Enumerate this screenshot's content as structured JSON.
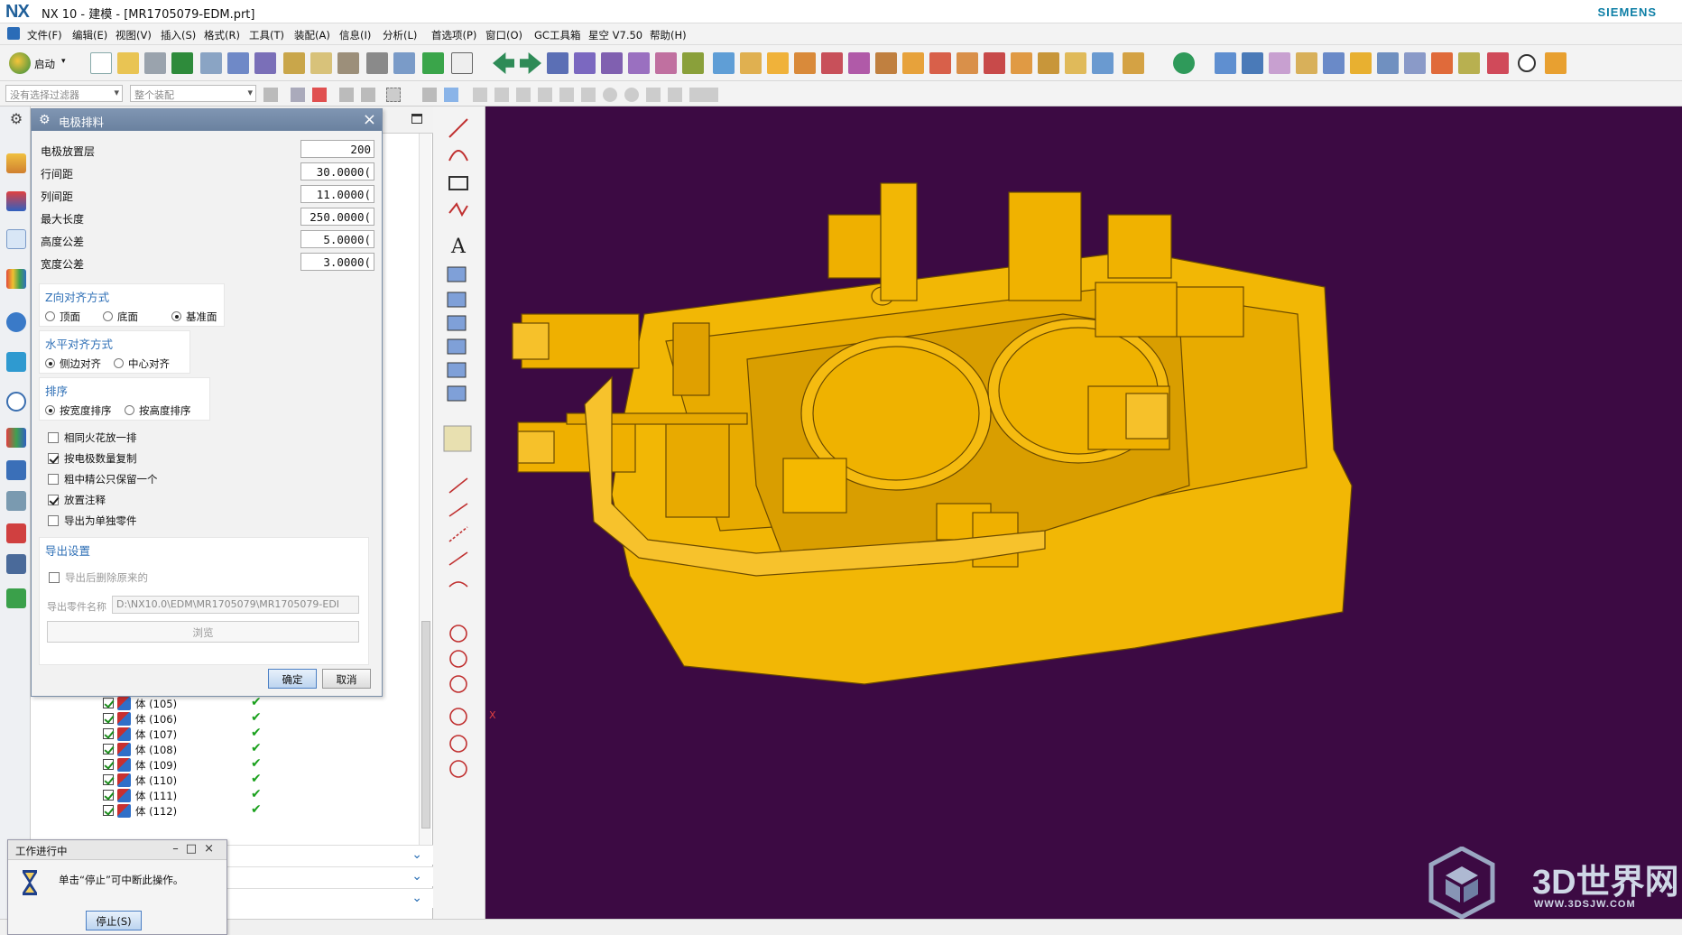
{
  "window": {
    "logo": "NX",
    "title": "NX 10 - 建模 - [MR1705079-EDM.prt]",
    "brand": "SIEMENS"
  },
  "menu": [
    "文件(F)",
    "编辑(E)",
    "视图(V)",
    "插入(S)",
    "格式(R)",
    "工具(T)",
    "装配(A)",
    "信息(I)",
    "分析(L)",
    "首选项(P)",
    "窗口(O)",
    "GC工具箱",
    "星空 V7.50",
    "帮助(H)"
  ],
  "toolbar": {
    "start_label": "启动",
    "filter_placeholder": "没有选择过滤器",
    "assembly_placeholder": "整个装配"
  },
  "dialog": {
    "title": "电极排料",
    "fields": [
      {
        "label": "电极放置层",
        "value": "200"
      },
      {
        "label": "行间距",
        "value": "30.0000("
      },
      {
        "label": "列间距",
        "value": "11.0000("
      },
      {
        "label": "最大长度",
        "value": "250.0000("
      },
      {
        "label": "高度公差",
        "value": "5.0000("
      },
      {
        "label": "宽度公差",
        "value": "3.0000("
      }
    ],
    "z_align": {
      "title": "Z向对齐方式",
      "options": [
        "顶面",
        "底面",
        "基准面"
      ],
      "selected": 2
    },
    "h_align": {
      "title": "水平对齐方式",
      "options": [
        "侧边对齐",
        "中心对齐"
      ],
      "selected": 0
    },
    "sort": {
      "title": "排序",
      "options": [
        "按宽度排序",
        "按高度排序"
      ],
      "selected": 0
    },
    "checkboxes": [
      {
        "label": "相同火花放一排",
        "checked": false
      },
      {
        "label": "按电极数量复制",
        "checked": true
      },
      {
        "label": "粗中精公只保留一个",
        "checked": false
      },
      {
        "label": "放置注释",
        "checked": true
      },
      {
        "label": "导出为单独零件",
        "checked": false
      }
    ],
    "export": {
      "title": "导出设置",
      "delete_label": "导出后删除原来的",
      "name_label": "导出零件名称",
      "name_value": "D:\\NX10.0\\EDM\\MR1705079\\MR1705079-EDI",
      "browse_label": "浏览"
    },
    "ok_label": "确定",
    "cancel_label": "取消"
  },
  "tree_rows": [
    "体 (105)",
    "体 (106)",
    "体 (107)",
    "体 (108)",
    "体 (109)",
    "体 (110)",
    "体 (111)",
    "体 (112)"
  ],
  "progress": {
    "title": "工作进行中",
    "message": "单击“停止”可中断此操作。",
    "stop_label": "停止(S)"
  },
  "triad": {
    "x_label": "X"
  },
  "watermark": {
    "text": "3D世界网",
    "url": "WWW.3DSJW.COM"
  },
  "colors": {
    "graphics_bg": "#3c0a43",
    "model": "#f2b705",
    "model_edge": "#6b4a00",
    "accent": "#2e6fb6"
  }
}
